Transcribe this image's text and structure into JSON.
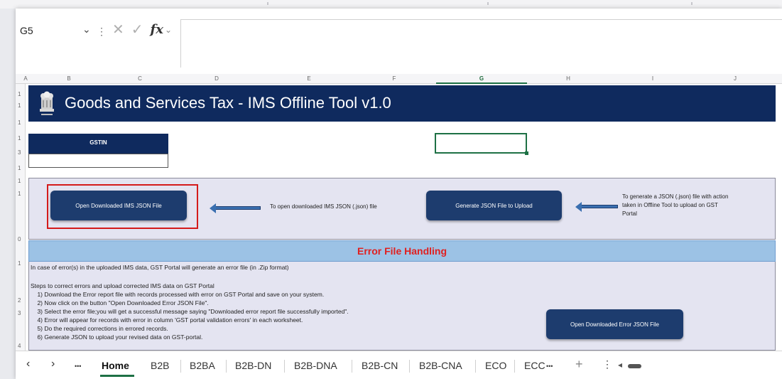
{
  "formula_bar": {
    "name_box": "G5",
    "name_box_arrow": "⌄",
    "separator": "⋮",
    "cancel_icon": "✕",
    "enter_icon": "✓",
    "fx_label": "fx",
    "fx_arrow": "⌄",
    "formula_value": ""
  },
  "columns": [
    "A",
    "B",
    "C",
    "D",
    "E",
    "F",
    "G",
    "H",
    "I",
    "J"
  ],
  "selected_column": "G",
  "rows": [
    "1",
    "1",
    "1",
    "1",
    "3",
    "1",
    "1",
    "1",
    "0",
    "1",
    "2",
    "3",
    "4"
  ],
  "banner": {
    "title": "Goods and Services Tax - IMS Offline Tool v1.0"
  },
  "gstin": {
    "label": "GSTIN",
    "value": ""
  },
  "actions": {
    "open_ims_button": "Open Downloaded IMS JSON File",
    "open_ims_hint": "To open downloaded IMS JSON (.json) file",
    "generate_button": "Generate JSON File to Upload",
    "generate_hint_lines": [
      "To generate a JSON (.json) file with action",
      "taken in Offline Tool to upload on GST",
      "Portal"
    ]
  },
  "error_section": {
    "title": "Error File Handling",
    "lines": [
      "In case of error(s) in the uploaded IMS data, GST Portal will generate an error file (in .Zip format)",
      "",
      "Steps to correct errors and upload corrected IMS data on GST Portal",
      "    1) Download the Error report file with records processed with error on GST Portal and save on your system.",
      "    2) Now click on the button \"Open Downloaded Error JSON File\".",
      "    3) Select the error file;you will get a successful message saying \"Downloaded error report file successfully imported\".",
      "    4) Error will appear for records with error in column 'GST portal validation errors' in each worksheet.",
      "    5) Do the required corrections in errored records.",
      "    6) Generate JSON to upload your revised data on GST-portal."
    ],
    "open_error_button": "Open Downloaded Error JSON File"
  },
  "sheet_tabs": {
    "prev": "‹",
    "next": "›",
    "more_left": "•••",
    "tabs": [
      "Home",
      "B2B",
      "B2BA",
      "B2B-DN",
      "B2B-DNA",
      "B2B-CN",
      "B2B-CNA",
      "ECO",
      "ECC"
    ],
    "active_tab": "Home",
    "more_right": "•••",
    "add": "+",
    "options": "⋮",
    "scroll_left": "◂"
  },
  "colors": {
    "banner_bg": "#0f2a5e",
    "button_bg": "#1d3c6e",
    "panel_bg": "#e4e4f1",
    "error_header_bg": "#9cc2e5",
    "error_title": "#e02020",
    "highlight_border": "#d41b1b",
    "excel_green": "#1e7145"
  }
}
